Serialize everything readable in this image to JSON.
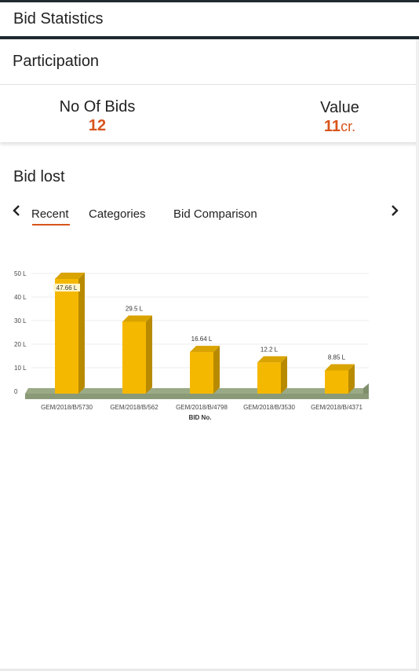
{
  "header": {
    "title": "Bid Statistics"
  },
  "participation": {
    "label": "Participation",
    "bids_label": "No Of Bids",
    "bids_value": "12",
    "value_label": "Value",
    "value_amount": "11",
    "value_unit": "cr."
  },
  "bid_lost": {
    "title": "Bid lost",
    "tabs": [
      "Recent",
      "Categories",
      "Bid Comparison"
    ],
    "active_tab": "Recent"
  },
  "colors": {
    "accent": "#d8541b",
    "bar": "#f5b800",
    "bar_dark": "#b88a00",
    "floor": "#9aaa86"
  },
  "icons": {
    "prev": "chevron-left-icon",
    "next": "chevron-right-icon"
  },
  "chart_data": {
    "type": "bar",
    "xlabel": "BID No.",
    "ylabel": "",
    "categories": [
      "GEM/2018/B/5730",
      "GEM/2018/B/562",
      "GEM/2018/B/4798",
      "GEM/2018/B/3530",
      "GEM/2018/B/4371"
    ],
    "values": [
      47.66,
      29.5,
      16.64,
      12.2,
      8.85
    ],
    "data_labels": [
      "47.66 L",
      "29.5 L",
      "16.64 L",
      "12.2 L",
      "8.85 L"
    ],
    "yticks": [
      "0",
      "10 L",
      "20 L",
      "30 L",
      "40 L",
      "50 L"
    ],
    "ylim": [
      0,
      50
    ],
    "grid": true,
    "style": "3d"
  }
}
